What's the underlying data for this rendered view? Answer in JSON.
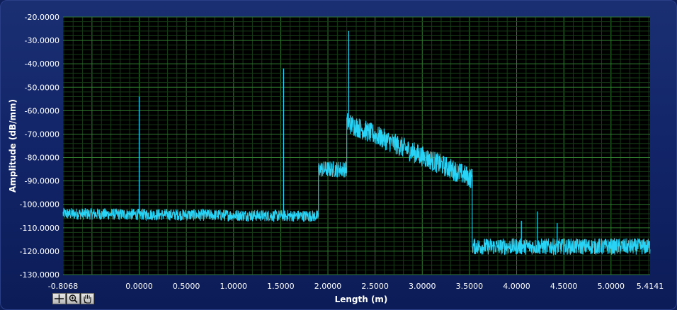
{
  "chart_data": {
    "type": "line",
    "xlabel": "Length (m)",
    "ylabel": "Amplitude (dB/mm)",
    "xlim": [
      -0.8068,
      5.4141
    ],
    "ylim": [
      -130,
      -20
    ],
    "x_ticks": [
      "-0.8068",
      "0.0000",
      "0.5000",
      "1.0000",
      "1.5000",
      "2.0000",
      "2.5000",
      "3.0000",
      "3.5000",
      "4.0000",
      "4.5000",
      "5.0000",
      "5.4141"
    ],
    "x_tick_values": [
      -0.8068,
      0,
      0.5,
      1,
      1.5,
      2,
      2.5,
      3,
      3.5,
      4,
      4.5,
      5,
      5.4141
    ],
    "y_ticks": [
      "-20.0000",
      "-30.0000",
      "-40.0000",
      "-50.0000",
      "-60.0000",
      "-70.0000",
      "-80.0000",
      "-90.0000",
      "-100.0000",
      "-110.0000",
      "-120.0000",
      "-130.0000"
    ],
    "y_tick_values": [
      -20,
      -30,
      -40,
      -50,
      -60,
      -70,
      -80,
      -90,
      -100,
      -110,
      -120,
      -130
    ],
    "grid": true,
    "series": [
      {
        "color": "#29d3f5",
        "segments": [
          {
            "x_start": -0.8068,
            "x_end": 1.9,
            "y_start": -104,
            "y_end": -105,
            "noise_db": 5
          },
          {
            "x_start": 1.9,
            "x_end": 2.2,
            "y_start": -85,
            "y_end": -85,
            "noise_db": 7
          },
          {
            "x_start": 2.2,
            "x_end": 3.53,
            "y_start": -65,
            "y_end": -89,
            "noise_db": 9
          },
          {
            "x_start": 3.53,
            "x_end": 5.4141,
            "y_start": -118,
            "y_end": -118,
            "noise_db": 7
          }
        ],
        "peaks": [
          {
            "x": 0.0,
            "y": -54
          },
          {
            "x": 1.53,
            "y": -42
          },
          {
            "x": 2.22,
            "y": -26
          },
          {
            "x": 4.22,
            "y": -103
          },
          {
            "x": 4.05,
            "y": -107
          },
          {
            "x": 4.43,
            "y": -108
          }
        ]
      }
    ]
  },
  "palette": {
    "cursor_icon": "crosshair-icon",
    "zoom_icon": "zoom-icon",
    "pan_icon": "hand-pan-icon"
  }
}
